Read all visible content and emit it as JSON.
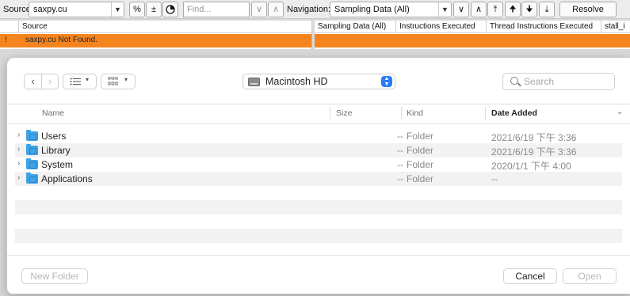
{
  "toolbar": {
    "source_label": "Source:",
    "source_value": "saxpy.cu",
    "find_placeholder": "Find...",
    "navigation_label": "Navigation:",
    "navigation_value": "Sampling Data (All)",
    "resolve_label": "Resolve"
  },
  "source_panel": {
    "column_header": "Source",
    "error_marker": "!",
    "error_message": "saxpy.cu Not Found."
  },
  "metrics_table": {
    "columns": [
      "Sampling Data (All)",
      "Instructions Executed",
      "Thread Instructions Executed",
      "stall_i"
    ]
  },
  "dialog": {
    "location": "Macintosh HD",
    "search_placeholder": "Search",
    "columns": {
      "name": "Name",
      "size": "Size",
      "kind": "Kind",
      "date_added": "Date Added"
    },
    "items": [
      {
        "name": "Users",
        "size": "--",
        "kind": "Folder",
        "date_added": "2021/6/19 下午 3:36"
      },
      {
        "name": "Library",
        "size": "--",
        "kind": "Folder",
        "date_added": "2021/6/19 下午 3:36"
      },
      {
        "name": "System",
        "size": "--",
        "kind": "Folder",
        "date_added": "2020/1/1 下午 4:00"
      },
      {
        "name": "Applications",
        "size": "--",
        "kind": "Folder",
        "date_added": "--"
      }
    ],
    "buttons": {
      "new_folder": "New Folder",
      "cancel": "Cancel",
      "open": "Open"
    }
  },
  "colors": {
    "error_row": "#f5841f",
    "folder_icon": "#3fa3e6",
    "accent": "#2a7cf5"
  }
}
